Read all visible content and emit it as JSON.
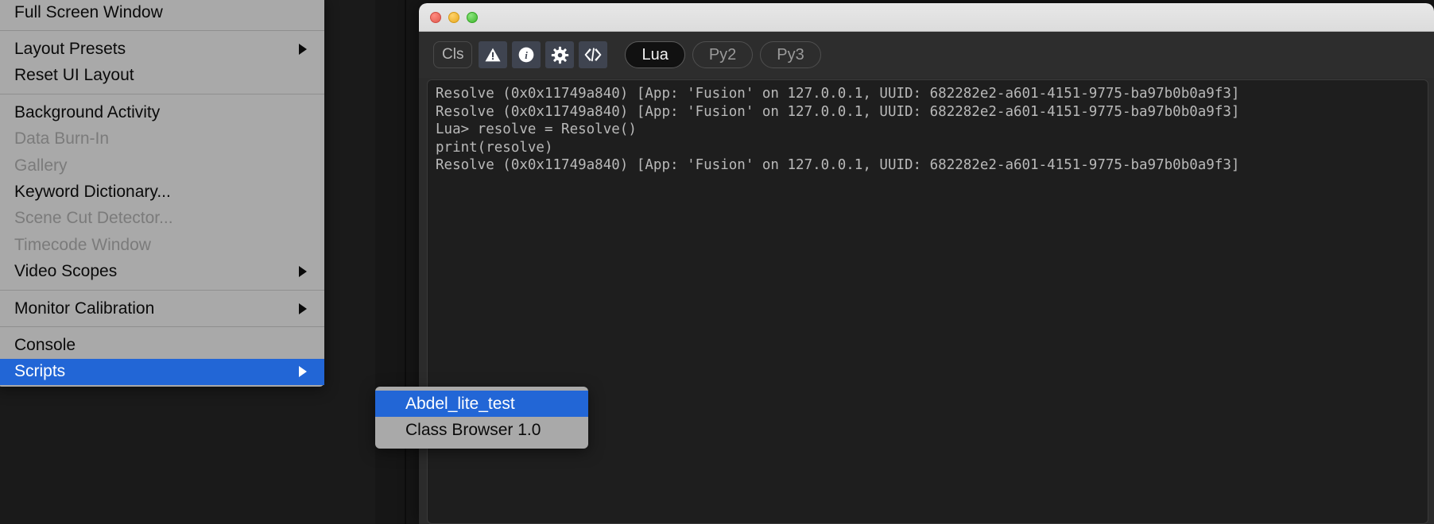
{
  "window": {
    "title_bar": {
      "close_label": "close",
      "minimize_label": "minimize",
      "maximize_label": "maximize"
    },
    "toolbar": {
      "clear_label": "Cls",
      "warning_icon": "warning-triangle-icon",
      "info_icon": "info-circle-icon",
      "settings_icon": "gear-icon",
      "code_icon": "code-brackets-icon",
      "languages": [
        {
          "label": "Lua",
          "active": true
        },
        {
          "label": "Py2",
          "active": false
        },
        {
          "label": "Py3",
          "active": false
        }
      ]
    },
    "console_output": "Resolve (0x0x11749a840) [App: 'Fusion' on 127.0.0.1, UUID: 682282e2-a601-4151-9775-ba97b0b0a9f3]\nResolve (0x0x11749a840) [App: 'Fusion' on 127.0.0.1, UUID: 682282e2-a601-4151-9775-ba97b0b0a9f3]\nLua> resolve = Resolve()\nprint(resolve)\nResolve (0x0x11749a840) [App: 'Fusion' on 127.0.0.1, UUID: 682282e2-a601-4151-9775-ba97b0b0a9f3]"
  },
  "menu": {
    "groups": [
      {
        "items": [
          {
            "label": "Full Screen Window",
            "disabled": false,
            "submenu": false,
            "selected": false
          }
        ]
      },
      {
        "items": [
          {
            "label": "Layout Presets",
            "disabled": false,
            "submenu": true,
            "selected": false
          },
          {
            "label": "Reset UI Layout",
            "disabled": false,
            "submenu": false,
            "selected": false
          }
        ]
      },
      {
        "items": [
          {
            "label": "Background Activity",
            "disabled": false,
            "submenu": false,
            "selected": false
          },
          {
            "label": "Data Burn-In",
            "disabled": true,
            "submenu": false,
            "selected": false
          },
          {
            "label": "Gallery",
            "disabled": true,
            "submenu": false,
            "selected": false
          },
          {
            "label": "Keyword Dictionary...",
            "disabled": false,
            "submenu": false,
            "selected": false
          },
          {
            "label": "Scene Cut Detector...",
            "disabled": true,
            "submenu": false,
            "selected": false
          },
          {
            "label": "Timecode Window",
            "disabled": true,
            "submenu": false,
            "selected": false
          },
          {
            "label": "Video Scopes",
            "disabled": false,
            "submenu": true,
            "selected": false
          }
        ]
      },
      {
        "items": [
          {
            "label": "Monitor Calibration",
            "disabled": false,
            "submenu": true,
            "selected": false
          }
        ]
      },
      {
        "items": [
          {
            "label": "Console",
            "disabled": false,
            "submenu": false,
            "selected": false
          },
          {
            "label": "Scripts",
            "disabled": false,
            "submenu": true,
            "selected": true
          }
        ]
      }
    ]
  },
  "submenu": {
    "items": [
      {
        "label": "Abdel_lite_test",
        "selected": true
      },
      {
        "label": "Class Browser 1.0",
        "selected": false
      }
    ]
  },
  "colors": {
    "menu_background": "#a9a9a9",
    "menu_highlight": "#2266d6",
    "console_background": "#1e1e1e",
    "console_text": "#b9b9b9",
    "toolbar_background": "#2d2d2d",
    "timeline_strip": "#c98b8b"
  }
}
